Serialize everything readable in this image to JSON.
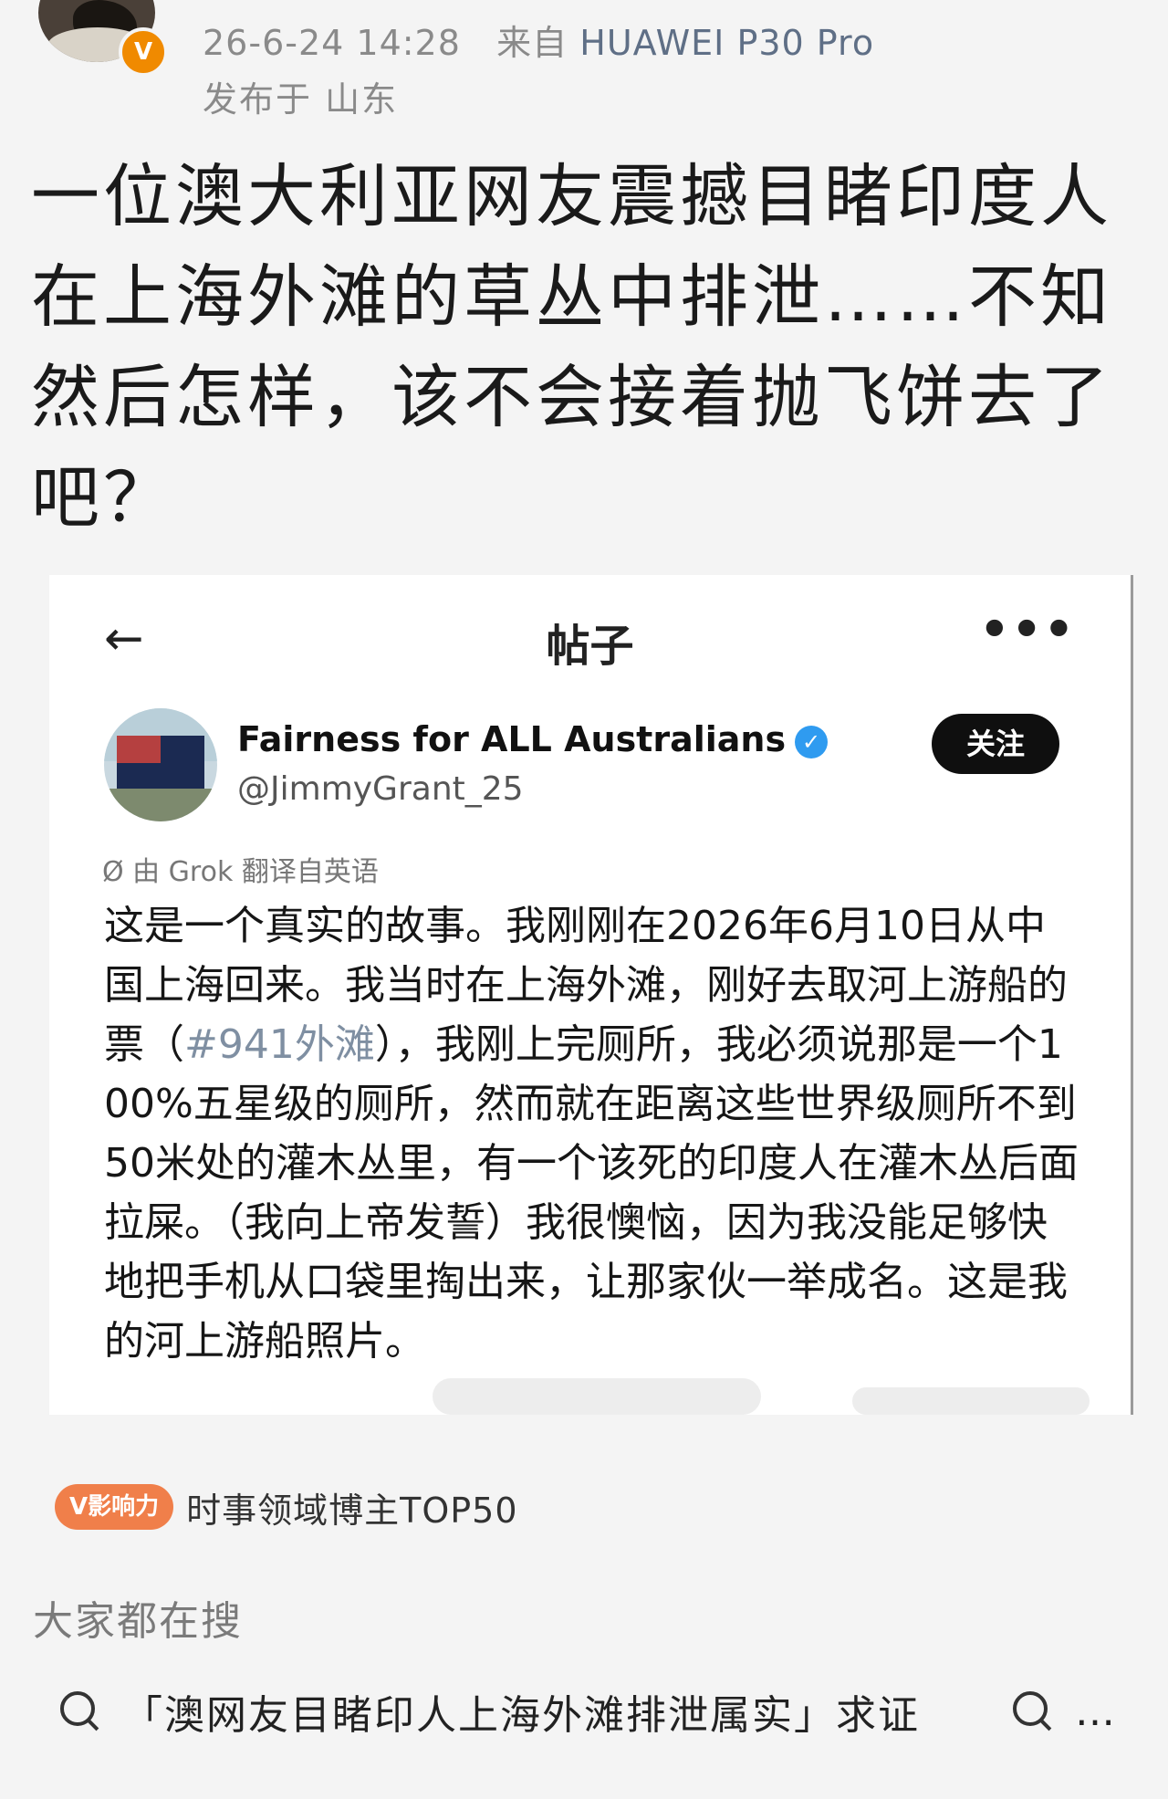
{
  "header": {
    "timestamp": "26-6-24 14:28",
    "source_prefix": "来自",
    "device": "HUAWEI P30 Pro",
    "location": "发布于 山东",
    "badge": "V"
  },
  "post": {
    "title": "一位澳大利亚网友震撼目睹印度人在上海外滩的草丛中排泄……不知然后怎样，该不会接着抛飞饼去了吧？"
  },
  "embedded_post": {
    "nav_title": "帖子",
    "back_icon": "←",
    "more_icon": "•••",
    "account_name": "Fairness for ALL Australians",
    "verified_icon": "✓",
    "handle": "@JimmyGrant_25",
    "follow_label": "关注",
    "translation_note": "Ø 由 Grok 翻译自英语",
    "body_before_tag": "这是一个真实的故事。我刚刚在2026年6月10日从中国上海回来。我当时在上海外滩，刚好去取河上游船的票（",
    "hashtag": "#941外滩",
    "body_after_tag": "），我刚上完厕所，我必须说那是一个100%五星级的厕所，然而就在距离这些世界级厕所不到50米处的灌木丛里，有一个该死的印度人在灌木丛后面拉屎。（我向上帝发誓）我很懊恼，因为我没能足够快地把手机从口袋里掏出来，让那家伙一举成名。这是我的河上游船照片。"
  },
  "influence": {
    "badge": "V影响力",
    "text": "时事领域博主TOP50"
  },
  "search": {
    "heading": "大家都在搜",
    "query": "「澳网友目睹印人上海外滩排泄属实」求证",
    "query2": "…"
  },
  "colors": {
    "background": "#f4f4f4",
    "meta_text": "#8a8a8a",
    "device_text": "#5f6f86",
    "badge_orange": "#f08a00",
    "influence_orange": "#f07f4a",
    "verified_blue": "#2f9bf0",
    "hashtag": "#7f8fa2"
  }
}
